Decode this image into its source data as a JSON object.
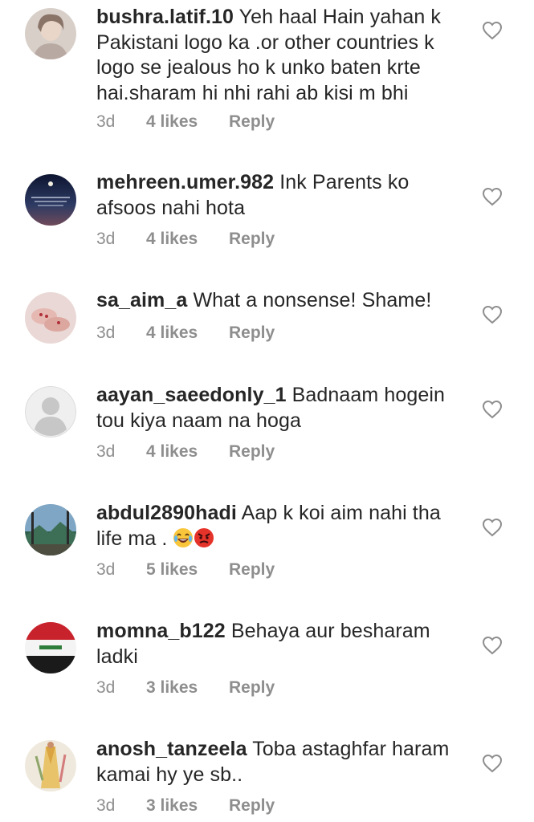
{
  "comments": [
    {
      "username": "bushra.latif.10",
      "text": "Yeh haal Hain yahan k Pakistani logo ka .or other countries k logo se jealous ho k unko baten krte hai.sharam hi nhi rahi ab kisi m bhi",
      "time": "3d",
      "likes": "4 likes",
      "reply": "Reply",
      "avatar": "avatar-photo-woman"
    },
    {
      "username": "mehreen.umer.982",
      "text": "Ink Parents ko afsoos nahi hota",
      "time": "3d",
      "likes": "4 likes",
      "reply": "Reply",
      "avatar": "avatar-night-sky"
    },
    {
      "username": "sa_aim_a",
      "text": "What a nonsense! Shame!",
      "time": "3d",
      "likes": "4 likes",
      "reply": "Reply",
      "avatar": "avatar-hands"
    },
    {
      "username": "aayan_saeedonly_1",
      "text": "Badnaam hogein tou kiya naam na hoga",
      "time": "3d",
      "likes": "4 likes",
      "reply": "Reply",
      "avatar": "avatar-default"
    },
    {
      "username": "abdul2890hadi",
      "text": "Aap k koi aim nahi tha life ma .",
      "emojis": [
        "laughing-tears-emoji",
        "angry-face-emoji"
      ],
      "time": "3d",
      "likes": "5 likes",
      "reply": "Reply",
      "avatar": "avatar-landscape"
    },
    {
      "username": "momna_b122",
      "text": "Behaya aur besharam ladki",
      "time": "3d",
      "likes": "3 likes",
      "reply": "Reply",
      "avatar": "avatar-flag"
    },
    {
      "username": "anosh_tanzeela",
      "text": "Toba astaghfar haram kamai hy ye sb..",
      "time": "3d",
      "likes": "3 likes",
      "reply": "Reply",
      "avatar": "avatar-fashion"
    }
  ],
  "colors": {
    "text": "#262626",
    "meta": "#8e8e8e",
    "heart_outline": "#8e8e8e"
  }
}
